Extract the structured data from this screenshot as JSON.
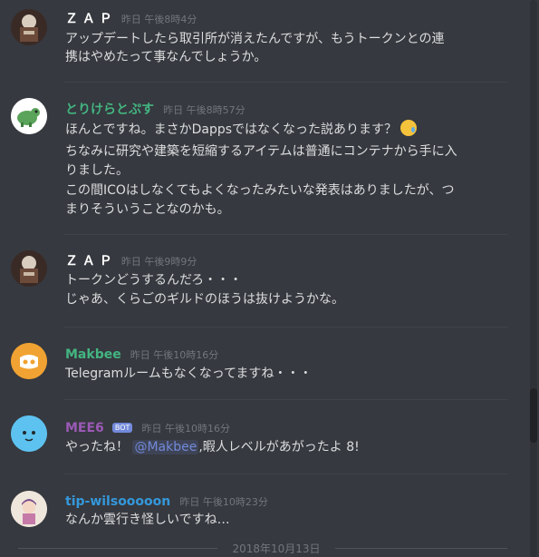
{
  "messages": [
    {
      "author": "Ｚ Ａ Ｐ",
      "author_color": "#ffffff",
      "timestamp": "昨日 午後8時4分",
      "lines": [
        "アップデートしたら取引所が消えたんですが、もうトークンとの連",
        "携はやめたって事なんでしょうか。"
      ]
    },
    {
      "author": "とりけらとぷす",
      "author_color": "#43b581",
      "timestamp": "昨日 午後8時57分",
      "lines": [
        "ほんとですね。まさかDappsではなくなった説あります？",
        "ちなみに研究や建築を短縮するアイテムは普通にコンテナから手に入",
        "りました。",
        "この間ICOはしなくてもよくなったみたいな発表はありましたが、つ",
        "まりそういうことなのかも。"
      ],
      "emoji": "crying-face-emoji"
    },
    {
      "author": "Ｚ Ａ Ｐ",
      "author_color": "#ffffff",
      "timestamp": "昨日 午後9時9分",
      "lines": [
        "トークンどうするんだろ・・・",
        "じゃあ、くらごのギルドのほうは抜けようかな。"
      ]
    },
    {
      "author": "Makbee",
      "author_color": "#43b581",
      "timestamp": "昨日 午後10時16分",
      "lines": [
        "Telegramルームもなくなってますね・・・"
      ]
    },
    {
      "author": "MEE6",
      "author_color": "#9b59b6",
      "bot_tag": "BOT",
      "timestamp": "昨日 午後10時16分",
      "line_pre": "やったね！ ",
      "mention": "@Makbee",
      "line_post": ",暇人レベルがあがったよ 8!"
    },
    {
      "author": "tip-wilsooooon",
      "author_color": "#3498db",
      "timestamp": "昨日 午後10時23分",
      "lines": [
        "なんか雲行き怪しいですね…"
      ]
    }
  ],
  "date_divider": "2018年10月13日",
  "colors": {
    "background": "#36393f",
    "text": "#dcddde",
    "timestamp": "#72767d",
    "mention": "#7289da"
  }
}
